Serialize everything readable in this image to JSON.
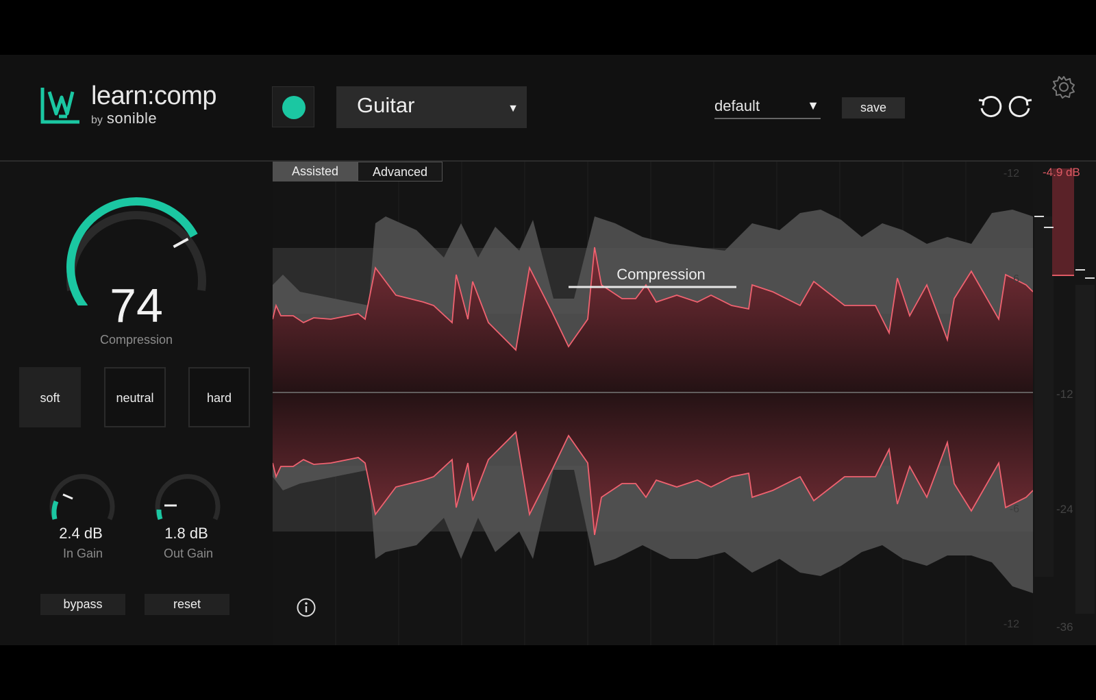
{
  "app": {
    "name": "learn:comp",
    "by": "by",
    "maker": "sonible",
    "accent_color": "#1bc7a2",
    "compression_color": "#e05a64"
  },
  "header": {
    "profile_label": "Guitar",
    "profile_arrow": "▼",
    "preset_label": "default",
    "preset_arrow": "▼",
    "save_label": "save",
    "icons": [
      "power-icon",
      "undo-icon",
      "redo-icon",
      "gear-icon"
    ]
  },
  "main": {
    "compression_value": "74",
    "compression_label": "Compression",
    "compression_level": 0.74,
    "modes": [
      {
        "label": "soft",
        "active": true
      },
      {
        "label": "neutral",
        "active": false
      },
      {
        "label": "hard",
        "active": false
      }
    ],
    "in_gain": {
      "value": "2.4 dB",
      "label": "In Gain"
    },
    "out_gain": {
      "value": "1.8 dB",
      "label": "Out Gain"
    },
    "bypass_label": "bypass",
    "reset_label": "reset"
  },
  "viz": {
    "tabs": [
      "Assisted",
      "Advanced"
    ],
    "active_tab": "Assisted",
    "compression_marker_label": "Compression",
    "left_scale": [
      "-12",
      "-6",
      "-6",
      "-12"
    ],
    "right_scale": [
      "-12",
      "-24",
      "-36"
    ],
    "gain_reduction": "-4.9 dB"
  }
}
